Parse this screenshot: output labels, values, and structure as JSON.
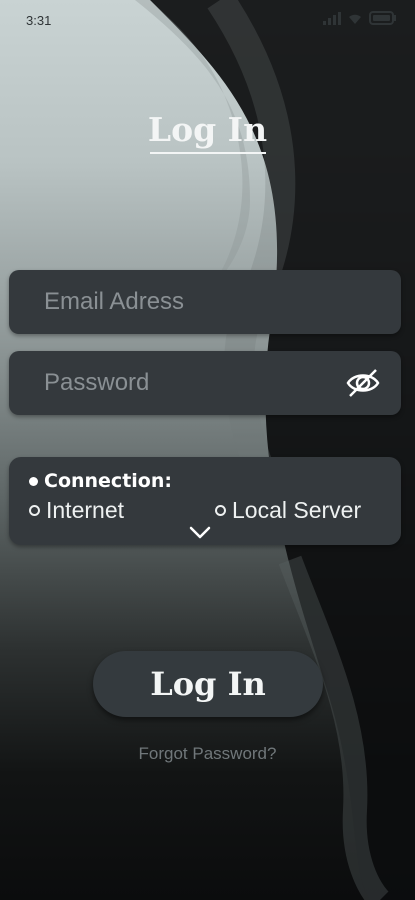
{
  "status_bar": {
    "time": "3:31"
  },
  "screen": {
    "title": "Log In"
  },
  "form": {
    "email": {
      "value": "",
      "placeholder": "Email Adress"
    },
    "password": {
      "value": "",
      "placeholder": "Password"
    }
  },
  "connection": {
    "label": "Connection:",
    "options": [
      "Internet",
      "Local Server"
    ]
  },
  "actions": {
    "login_label": "Log In",
    "forgot_label": "Forgot Password?"
  },
  "icons": {
    "signal": "signal-icon",
    "wifi": "wifi-icon",
    "battery": "battery-icon",
    "eye": "eye-icon",
    "chevron": "chevron-down-icon"
  },
  "colors": {
    "field_bg": "#34393d",
    "text_primary": "#f3f5f5",
    "text_muted": "#8a9094"
  }
}
